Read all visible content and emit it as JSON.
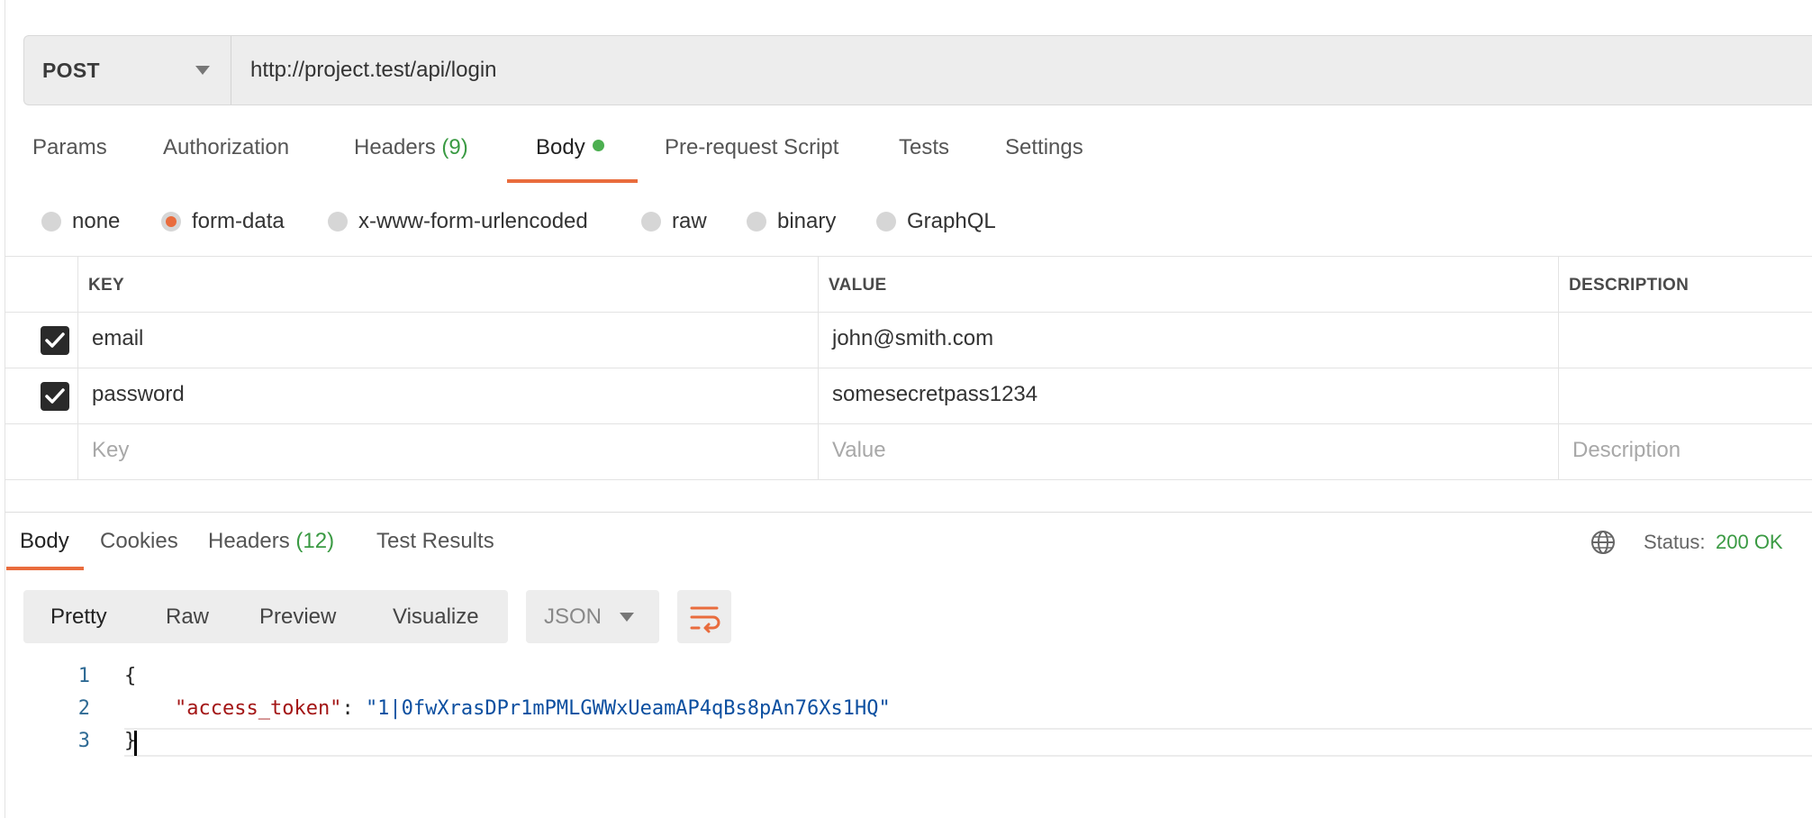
{
  "request": {
    "method": "POST",
    "url": "http://project.test/api/login"
  },
  "request_tabs": [
    {
      "label": "Params"
    },
    {
      "label": "Authorization"
    },
    {
      "label": "Headers",
      "count": "(9)"
    },
    {
      "label": "Body",
      "active": true,
      "indicator": "green-dot"
    },
    {
      "label": "Pre-request Script"
    },
    {
      "label": "Tests"
    },
    {
      "label": "Settings"
    }
  ],
  "body_types": [
    {
      "label": "none"
    },
    {
      "label": "form-data",
      "selected": true
    },
    {
      "label": "x-www-form-urlencoded"
    },
    {
      "label": "raw"
    },
    {
      "label": "binary"
    },
    {
      "label": "GraphQL"
    }
  ],
  "params_table": {
    "headers": [
      "KEY",
      "VALUE",
      "DESCRIPTION"
    ],
    "rows": [
      {
        "checked": true,
        "key": "email",
        "value": "john@smith.com",
        "description": ""
      },
      {
        "checked": true,
        "key": "password",
        "value": "somesecretpass1234",
        "description": ""
      }
    ],
    "placeholders": {
      "key": "Key",
      "value": "Value",
      "description": "Description"
    }
  },
  "response_tabs": [
    {
      "label": "Body",
      "active": true
    },
    {
      "label": "Cookies"
    },
    {
      "label": "Headers",
      "count": "(12)"
    },
    {
      "label": "Test Results"
    }
  ],
  "response_status": {
    "label": "Status:",
    "value": "200 OK",
    "icon": "globe-icon"
  },
  "view_modes": [
    {
      "label": "Pretty",
      "active": true
    },
    {
      "label": "Raw"
    },
    {
      "label": "Preview"
    },
    {
      "label": "Visualize"
    }
  ],
  "format": {
    "selected": "JSON"
  },
  "wrap_icon": "wrap-lines-icon",
  "response_body": {
    "line_numbers": [
      "1",
      "2",
      "3"
    ],
    "open_brace": "{",
    "key": "\"access_token\"",
    "colon": ": ",
    "value": "\"1|0fwXrasDPr1mPMLGWWxUeamAP4qBs8pAn76Xs1HQ\"",
    "close_brace": "}"
  },
  "colors": {
    "accent": "#e96c3d",
    "success": "#3a9a43",
    "json_key": "#a31515",
    "json_string": "#0c4fa0"
  }
}
